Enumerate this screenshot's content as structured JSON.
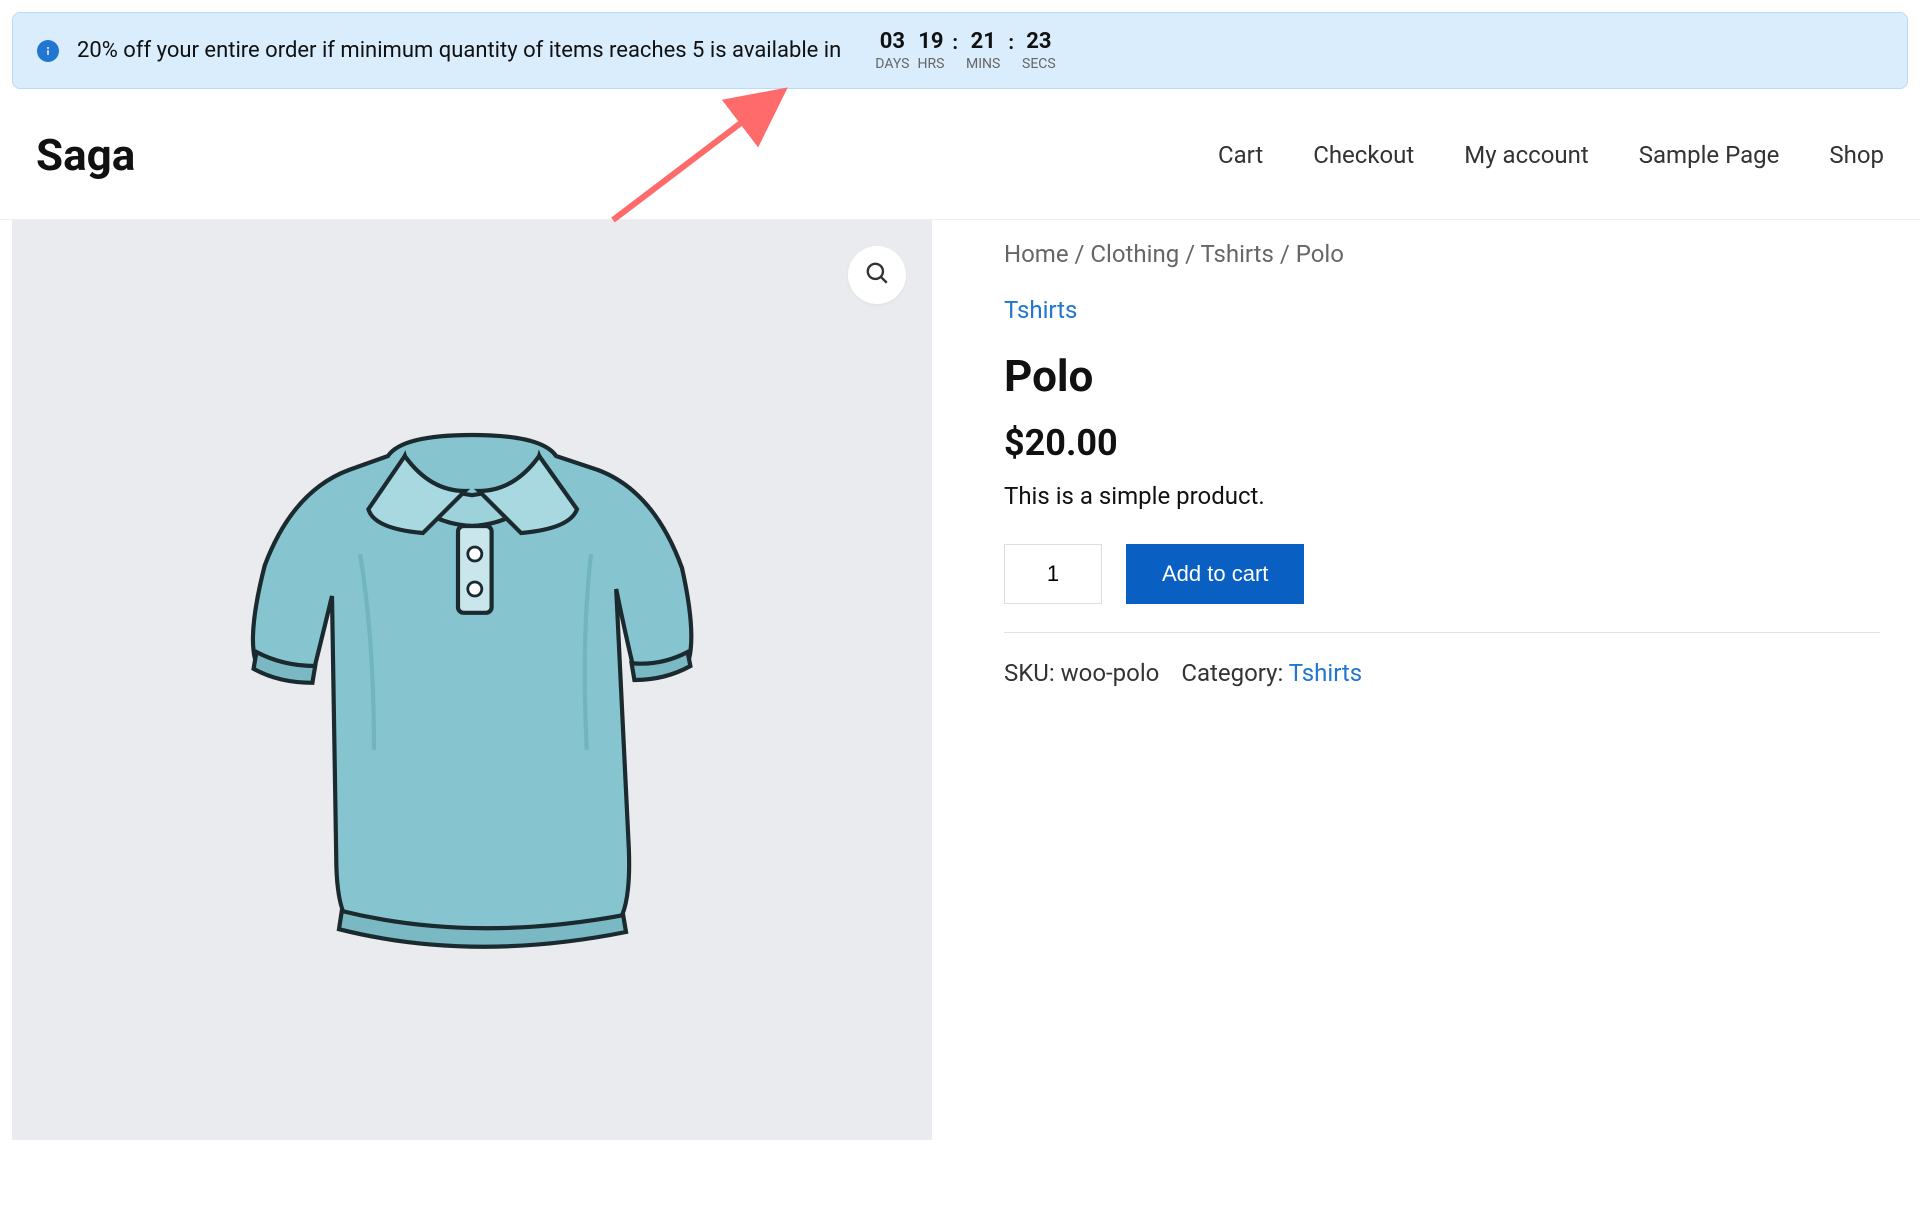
{
  "promo": {
    "text": "20% off your entire order if minimum quantity of items reaches 5 is available in",
    "countdown": {
      "days": {
        "value": "03",
        "label": "DAYS"
      },
      "hrs": {
        "value": "19",
        "label": "HRS"
      },
      "mins": {
        "value": "21",
        "label": "MINS"
      },
      "secs": {
        "value": "23",
        "label": "SECS"
      }
    }
  },
  "brand": "Saga",
  "nav": {
    "cart": "Cart",
    "checkout": "Checkout",
    "account": "My account",
    "sample": "Sample Page",
    "shop": "Shop"
  },
  "breadcrumb": {
    "home": "Home",
    "clothing": "Clothing",
    "tshirts": "Tshirts",
    "polo": "Polo",
    "sep": " / "
  },
  "product": {
    "category_link": "Tshirts",
    "title": "Polo",
    "price": "$20.00",
    "description": "This is a simple product.",
    "quantity": "1",
    "add_to_cart": "Add to cart",
    "sku_label": "SKU: ",
    "sku_value": "woo-polo",
    "category_label": "Category: ",
    "category_value": "Tshirts"
  }
}
